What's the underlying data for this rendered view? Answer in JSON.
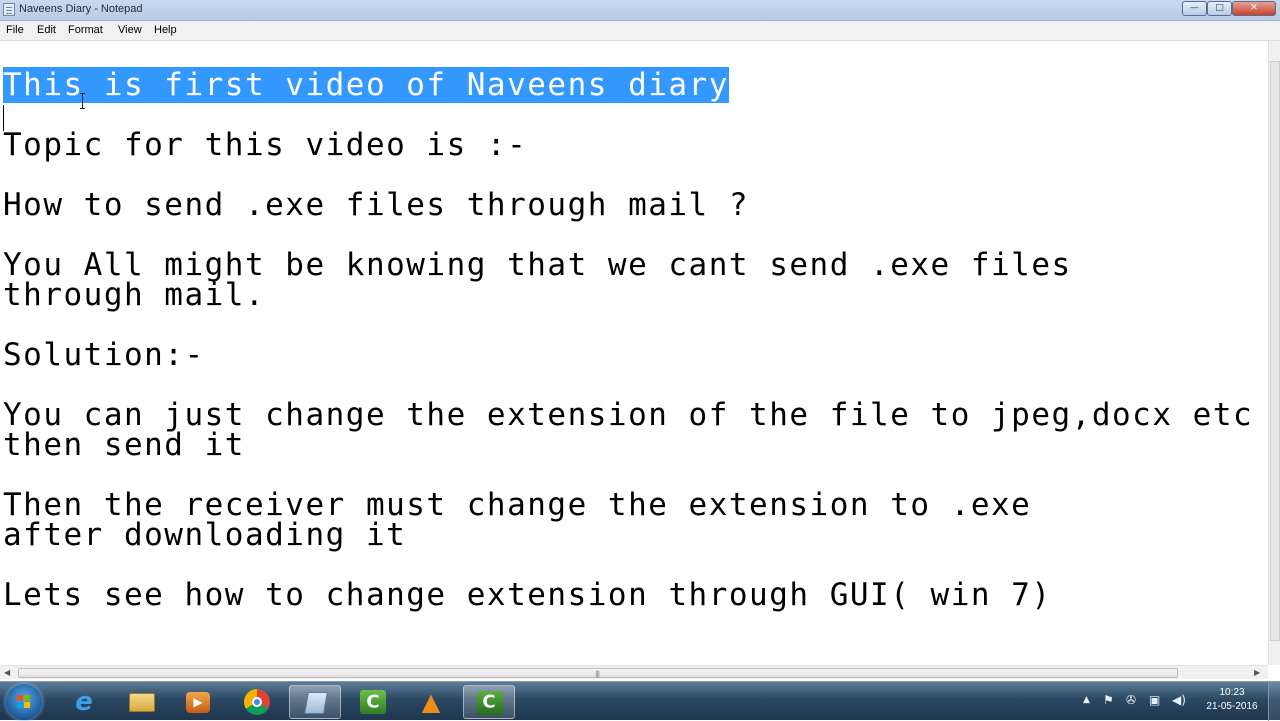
{
  "window": {
    "title": "Naveens Diary - Notepad",
    "controls": {
      "minimize": "—",
      "maximize": "□",
      "close": "✕"
    }
  },
  "menu": [
    "File",
    "Edit",
    "Format",
    "View",
    "Help"
  ],
  "document": {
    "lines": [
      "This is first video of Naveens diary",
      "",
      "Topic for this video is :-",
      "",
      "How to send .exe files through mail ?",
      "",
      "You All might be knowing that we cant send .exe files",
      "through mail.",
      "",
      "Solution:-",
      "",
      "You can just change the extension of the file to jpeg,docx etc",
      "then send it",
      "",
      "Then the receiver must change the extension to .exe",
      "after downloading it",
      "",
      "Lets see how to change extension through GUI( win 7)"
    ],
    "selected_line_index": 0
  },
  "taskbar": {
    "pinned": [
      {
        "name": "internet-explorer-icon",
        "glyph": "e"
      },
      {
        "name": "file-explorer-icon",
        "glyph": ""
      },
      {
        "name": "media-player-icon",
        "glyph": "▶"
      },
      {
        "name": "chrome-icon",
        "glyph": ""
      },
      {
        "name": "notepad-icon",
        "glyph": ""
      },
      {
        "name": "camtasia-recorder-icon",
        "glyph": "C"
      },
      {
        "name": "vlc-icon",
        "glyph": "▲"
      },
      {
        "name": "camtasia-studio-icon",
        "glyph": "C"
      }
    ],
    "clock": {
      "time": "10:23",
      "date": "21-05-2016"
    }
  },
  "colors": {
    "selection": "#3399ff",
    "taskbar": "#2c4862",
    "close_button": "#c8422e"
  }
}
